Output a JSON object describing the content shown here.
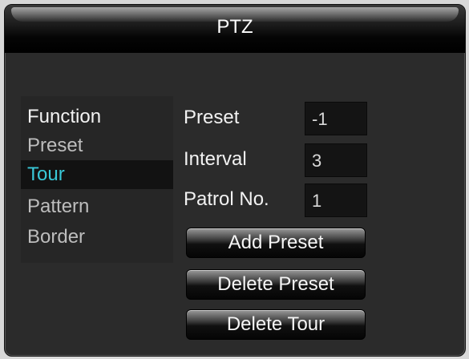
{
  "window": {
    "title": "PTZ"
  },
  "menu": {
    "header": "Function",
    "items": [
      {
        "label": "Preset",
        "selected": false
      },
      {
        "label": "Tour",
        "selected": true
      },
      {
        "label": "Pattern",
        "selected": false
      },
      {
        "label": "Border",
        "selected": false
      }
    ]
  },
  "form": {
    "preset_label": "Preset",
    "preset_value": "-1",
    "interval_label": "Interval",
    "interval_value": "3",
    "patrol_label": "Patrol No.",
    "patrol_value": "1"
  },
  "buttons": {
    "add_preset": "Add Preset",
    "delete_preset": "Delete Preset",
    "delete_tour": "Delete Tour"
  },
  "colors": {
    "selected_text": "#39c8d8",
    "background": "#2b2b2b"
  }
}
